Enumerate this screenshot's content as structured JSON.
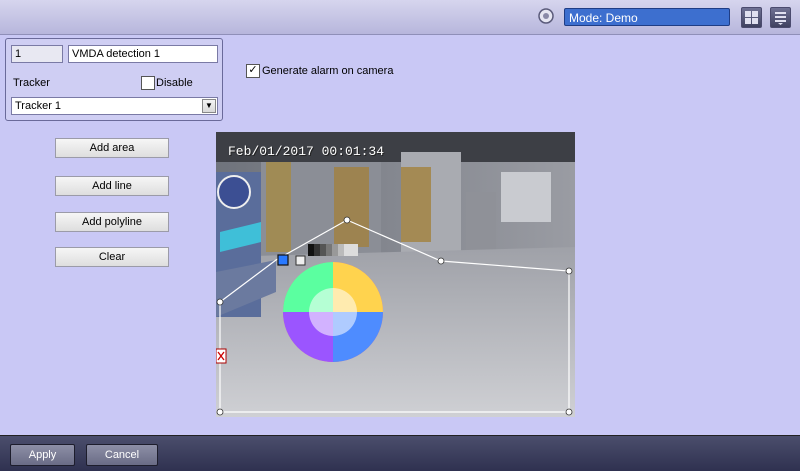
{
  "header": {
    "mode_label": "Mode: Demo",
    "mode_icon": "gear-icon",
    "layout_icon": "grid-layout-icon",
    "menu_icon": "menu-list-icon"
  },
  "props": {
    "id_value": "1",
    "name_value": "VMDA detection 1",
    "tracker_label": "Tracker",
    "disable_label": "Disable",
    "disable_checked": false,
    "tracker_selected": "Tracker 1"
  },
  "options": {
    "generate_alarm_label": "Generate alarm on camera",
    "generate_alarm_checked": true
  },
  "actions": {
    "add_area": "Add area",
    "add_line": "Add line",
    "add_polyline": "Add polyline",
    "clear": "Clear"
  },
  "video": {
    "timestamp": "Feb/01/2017  00:01:34"
  },
  "footer": {
    "apply": "Apply",
    "cancel": "Cancel"
  },
  "colors": {
    "background": "#c9c8f5",
    "mode_box": "#3d6fcf",
    "footer": "#3a3c5a"
  }
}
